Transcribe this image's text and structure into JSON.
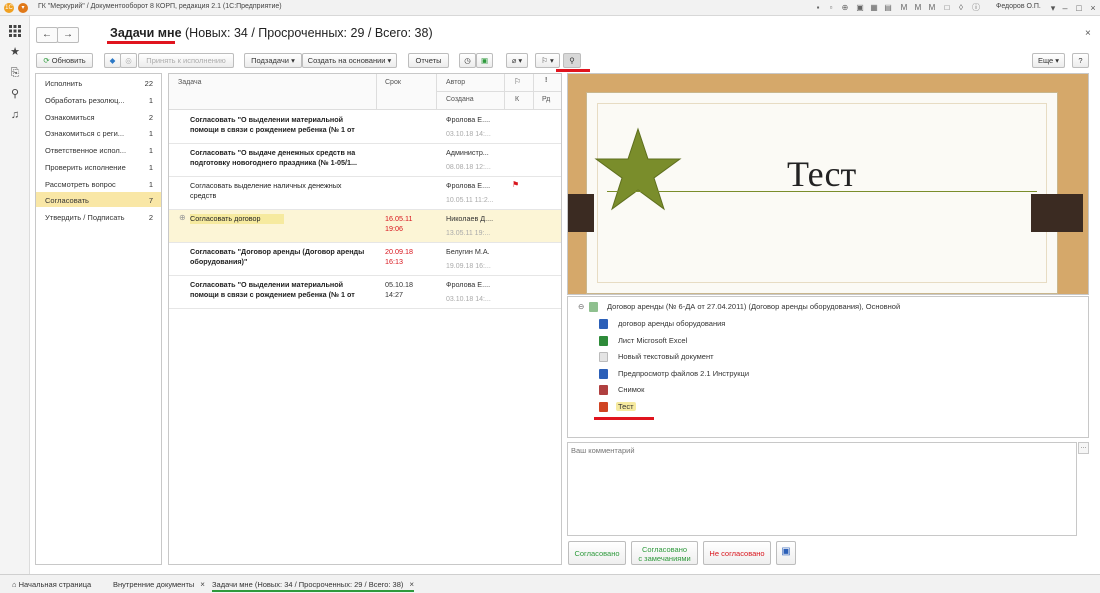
{
  "app": {
    "window_title": "ГК \"Меркурий\" / Документооборот 8 КОРП, редакция 2.1  (1С:Предприятие)",
    "user": "Федоров О.П."
  },
  "header": {
    "title_bold": "Задачи мне",
    "title_rest": " (Новых: 34 / Просроченных: 29 / Всего: 38)"
  },
  "toolbar": {
    "refresh": "Обновить",
    "accept": "Принять к исполнению",
    "subtasks": "Подзадачи",
    "create_based": "Создать на основании",
    "reports": "Отчеты",
    "more": "Еще",
    "help": "?"
  },
  "categories": [
    {
      "label": "Исполнить",
      "count": "22"
    },
    {
      "label": "Обработать резолюц...",
      "count": "1"
    },
    {
      "label": "Ознакомиться",
      "count": "2"
    },
    {
      "label": "Ознакомиться с реги...",
      "count": "1"
    },
    {
      "label": "Ответственное испол...",
      "count": "1"
    },
    {
      "label": "Проверить исполнение",
      "count": "1"
    },
    {
      "label": "Рассмотреть вопрос",
      "count": "1"
    },
    {
      "label": "Согласовать",
      "count": "7"
    },
    {
      "label": "Утвердить / Подписать",
      "count": "2"
    }
  ],
  "table": {
    "col_task": "Задача",
    "col_due": "Срок",
    "col_author": "Автор",
    "col_created": "Создана",
    "col_k": "К",
    "col_rd": "Рд",
    "rows": [
      {
        "task": "Согласовать \"О выделении материальной помощи в связи с рождением ребенка (№ 1 от",
        "due1": "",
        "due2": "",
        "author": "Фролова Е....",
        "created": "03.10.18 14:..."
      },
      {
        "task": "Согласовать \"О выдаче денежных средств на подготовку новогоднего праздника (№ 1-05/1...",
        "due1": "",
        "due2": "",
        "author": "Администр...",
        "created": "08.08.18 12:..."
      },
      {
        "task": "Согласовать выделение наличных денежных средств",
        "due1": "",
        "due2": "",
        "author": "Фролова Е....",
        "created": "10.05.11 11:2..."
      },
      {
        "task": "Согласовать договор",
        "due1": "16.05.11",
        "due2": "19:06",
        "author": "Николаев Д....",
        "created": "13.05.11 19:..."
      },
      {
        "task": "Согласовать \"Договор аренды (Договор аренды оборудования)\"",
        "due1": "20.09.18",
        "due2": "16:13",
        "author": "Белугин М.А.",
        "created": "19.09.18 16:..."
      },
      {
        "task": "Согласовать \"О выделении материальной помощи в связи с рождением ребенка (№ 1 от",
        "due1": "05.10.18",
        "due2": "14:27",
        "author": "Фролова Е....",
        "created": "03.10.18 14:..."
      }
    ]
  },
  "preview": {
    "slide_title": "Тест"
  },
  "files": {
    "root": "Договор аренды (№ 6-ДА от 27.04.2011) (Договор аренды оборудования), Основной",
    "items": [
      {
        "name": "договор аренды оборудования",
        "icon": "word-icon",
        "color": "#2b5fb8"
      },
      {
        "name": "Лист Microsoft Excel",
        "icon": "excel-icon",
        "color": "#2e8b3a"
      },
      {
        "name": "Новый текстовый документ",
        "icon": "text-file-icon",
        "color": "#bbbbbb"
      },
      {
        "name": "Предпросмотр файлов 2.1 Инструкци",
        "icon": "word-icon",
        "color": "#2b5fb8"
      },
      {
        "name": "Снимок",
        "icon": "image-icon",
        "color": "#b04040"
      },
      {
        "name": "Тест",
        "icon": "powerpoint-icon",
        "color": "#d04423"
      }
    ]
  },
  "comment": {
    "placeholder": "Ваш комментарий"
  },
  "actions": {
    "agreed": "Согласовано",
    "agreed_remarks_1": "Согласовано",
    "agreed_remarks_2": "с замечаниями",
    "not_agreed": "Не согласовано"
  },
  "tabs": [
    {
      "label": "Начальная страница"
    },
    {
      "label": "Внутренние документы"
    },
    {
      "label": "Задачи мне (Новых: 34 / Просроченных: 29 / Всего: 38)"
    }
  ],
  "colors": {
    "selection": "#f9e7a6",
    "accent_red": "#e0141e",
    "green": "#2e9a3c",
    "overdue": "#d8151d"
  }
}
